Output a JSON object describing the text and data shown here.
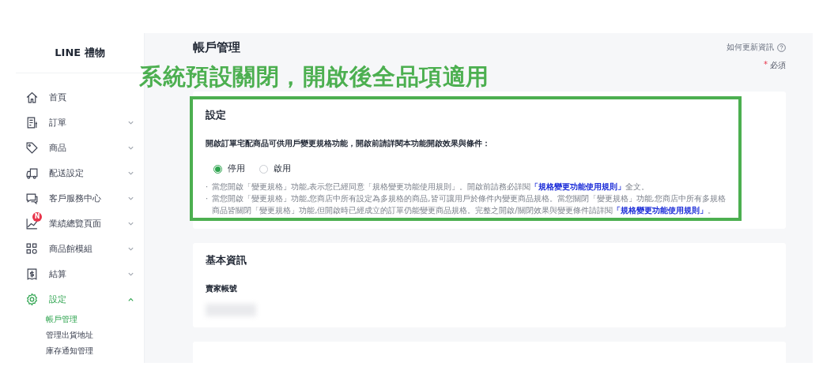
{
  "sidebar": {
    "logo": "LINE 禮物",
    "items": [
      {
        "label": "首頁",
        "selected": false
      },
      {
        "label": "訂單",
        "expanded": false,
        "selected": false
      },
      {
        "label": "商品",
        "expanded": false,
        "selected": false
      },
      {
        "label": "配送設定",
        "expanded": false,
        "selected": false
      },
      {
        "label": "客戶服務中心",
        "expanded": false,
        "selected": false
      },
      {
        "label": "業績總覽頁面",
        "badge": "N",
        "expanded": false,
        "selected": false
      },
      {
        "label": "商品館模組",
        "expanded": false,
        "selected": false
      },
      {
        "label": "結算",
        "expanded": false,
        "selected": false
      },
      {
        "label": "設定",
        "expanded": true,
        "selected": true,
        "children": [
          {
            "label": "帳戶管理",
            "selected": true
          },
          {
            "label": "管理出貨地址",
            "selected": false
          },
          {
            "label": "庫存通知管理",
            "selected": false
          }
        ]
      }
    ]
  },
  "page": {
    "title": "帳戶管理",
    "help_link": "如何更新資訊",
    "required_mark": "*",
    "required_note": "必須"
  },
  "annotation": {
    "text": "系統預設關閉，開啟後全品項適用"
  },
  "settings_card": {
    "title": "設定",
    "description": "開啟訂單宅配商品可供用戶變更規格功能，開啟前請詳閱本功能開啟效果與條件：",
    "options": [
      {
        "label": "停用",
        "selected": true
      },
      {
        "label": "啟用",
        "selected": false
      }
    ],
    "notes": [
      {
        "marker": "·",
        "text": "當您開啟「變更規格」功能,表示您已經同意「規格變更功能使用規則」。開啟前請務必詳閱",
        "link": "「規格變更功能使用規則」",
        "after": "全文。"
      },
      {
        "marker": "·",
        "text": "當您開啟「變更規格」功能,您商店中所有設定為多規格的商品,皆可讓用戶於條件內變更商品規格。當您關閉「變更規格」功能,您商店中所有多規格商品皆關閉「變更規格」功能,但開啟時已經成立的訂單仍能變更商品規格。完整之開啟/關閉效果與變更條件請詳閱",
        "link": "「規格變更功能使用規則」",
        "after": "。"
      }
    ]
  },
  "basic_card": {
    "title": "基本資訊",
    "field_label": "賣家帳號"
  }
}
